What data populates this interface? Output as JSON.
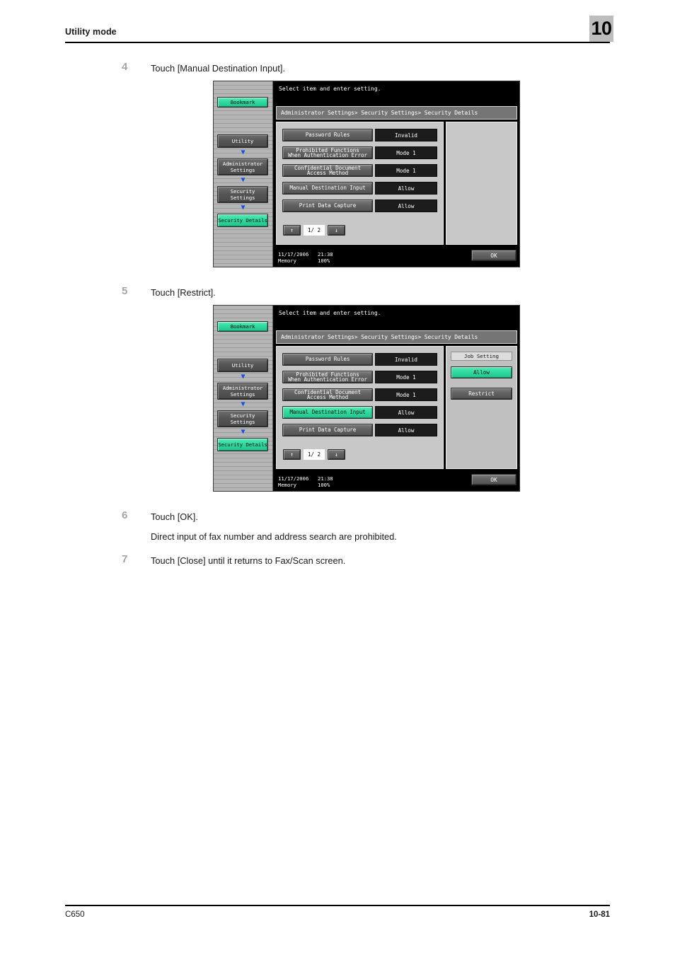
{
  "header": {
    "title": "Utility mode",
    "chapter": "10"
  },
  "footer": {
    "model": "C650",
    "page": "10-81"
  },
  "steps": [
    {
      "num": "4",
      "text": "Touch [Manual Destination Input]."
    },
    {
      "num": "5",
      "text": "Touch [Restrict]."
    },
    {
      "num": "6",
      "text": "Touch [OK].",
      "sub": "Direct input of fax number and address search are prohibited."
    },
    {
      "num": "7",
      "text": "Touch [Close] until it returns to Fax/Scan screen."
    }
  ],
  "colors": {
    "accent_green": "#2ddba0",
    "panel_gray": "#c8c8c8",
    "button_gray": "#616161",
    "value_dark": "#1c1c1c",
    "arrow_blue": "#1352e8",
    "chapter_badge": "#bdbdbd"
  },
  "panel1": {
    "message": "Select item and enter setting.",
    "breadcrumb": "Administrator Settings> Security Settings> Security Details",
    "sidebar": {
      "bookmark": "Bookmark",
      "items": [
        {
          "label": "Utility",
          "selected": false
        },
        {
          "label": "Administrator\nSettings",
          "selected": false
        },
        {
          "label": "Security\nSettings",
          "selected": false
        },
        {
          "label": "Security Details",
          "selected": true
        }
      ]
    },
    "rows": [
      {
        "key_line1": "Password Rules",
        "key_line2": "",
        "value": "Invalid",
        "selected": false
      },
      {
        "key_line1": "Prohibited Functions",
        "key_line2": "When Authentication Error",
        "value": "Mode 1",
        "selected": false
      },
      {
        "key_line1": "Confidential Document",
        "key_line2": "Access Method",
        "value": "Mode 1",
        "selected": false
      },
      {
        "key_line1": "Manual Destination Input",
        "key_line2": "",
        "value": "Allow",
        "selected": false
      },
      {
        "key_line1": "Print Data Capture",
        "key_line2": "",
        "value": "Allow",
        "selected": false
      }
    ],
    "pager": {
      "up": "↑",
      "label": "1/ 2",
      "down": "↓"
    },
    "status": {
      "date": "11/17/2006",
      "time": "21:38",
      "memory_label": "Memory",
      "memory_value": "100%"
    },
    "ok": "OK"
  },
  "panel2": {
    "message": "Select item and enter setting.",
    "breadcrumb": "Administrator Settings> Security Settings> Security Details",
    "sidebar": {
      "bookmark": "Bookmark",
      "items": [
        {
          "label": "Utility",
          "selected": false
        },
        {
          "label": "Administrator\nSettings",
          "selected": false
        },
        {
          "label": "Security\nSettings",
          "selected": false
        },
        {
          "label": "Security Details",
          "selected": true
        }
      ]
    },
    "rows": [
      {
        "key_line1": "Password Rules",
        "key_line2": "",
        "value": "Invalid",
        "selected": false
      },
      {
        "key_line1": "Prohibited Functions",
        "key_line2": "When Authentication Error",
        "value": "Mode 1",
        "selected": false
      },
      {
        "key_line1": "Confidential Document",
        "key_line2": "Access Method",
        "value": "Mode 1",
        "selected": false
      },
      {
        "key_line1": "Manual Destination Input",
        "key_line2": "",
        "value": "Allow",
        "selected": true
      },
      {
        "key_line1": "Print Data Capture",
        "key_line2": "",
        "value": "Allow",
        "selected": false
      }
    ],
    "job_setting": {
      "title": "Job Setting",
      "options": [
        {
          "label": "Allow",
          "selected": true
        },
        {
          "label": "Restrict",
          "selected": false
        }
      ]
    },
    "pager": {
      "up": "↑",
      "label": "1/ 2",
      "down": "↓"
    },
    "status": {
      "date": "11/17/2006",
      "time": "21:38",
      "memory_label": "Memory",
      "memory_value": "100%"
    },
    "ok": "OK"
  }
}
